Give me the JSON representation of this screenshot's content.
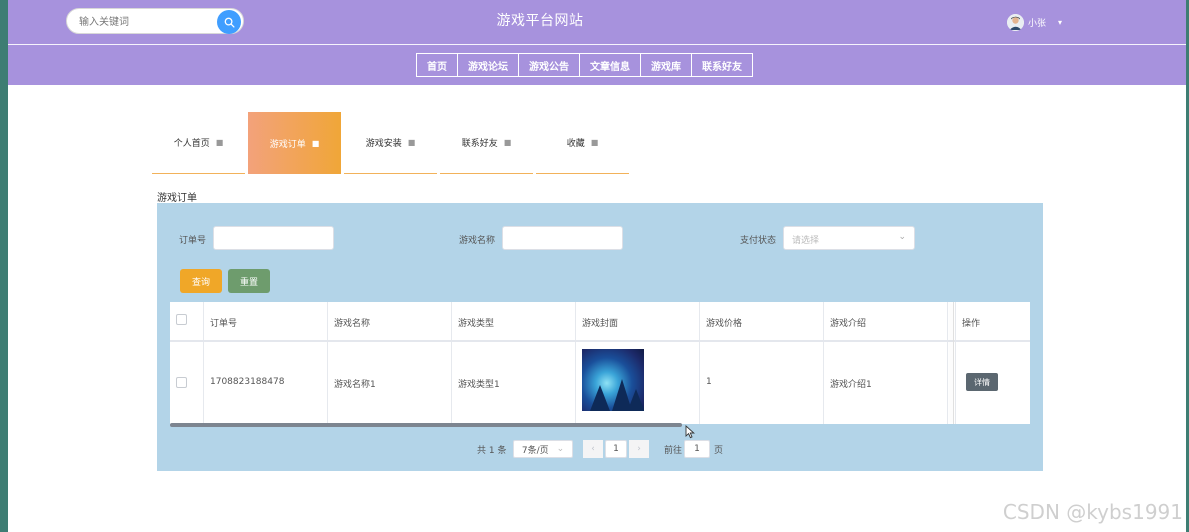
{
  "header": {
    "site_title": "游戏平台网站",
    "search_placeholder": "输入关键词",
    "user_name": "小张"
  },
  "nav": [
    "首页",
    "游戏论坛",
    "游戏公告",
    "文章信息",
    "游戏库",
    "联系好友"
  ],
  "tabs": [
    "个人首页",
    "游戏订单",
    "游戏安装",
    "联系好友",
    "收藏"
  ],
  "active_tab": "游戏订单",
  "section_title": "游戏订单",
  "filters": {
    "order_no_label": "订单号",
    "game_name_label": "游戏名称",
    "pay_status_label": "支付状态",
    "pay_status_placeholder": "请选择"
  },
  "buttons": {
    "query": "查询",
    "reset": "重置",
    "detail": "详情"
  },
  "table": {
    "columns": [
      "订单号",
      "游戏名称",
      "游戏类型",
      "游戏封面",
      "游戏价格",
      "游戏介绍",
      "操作"
    ],
    "rows": [
      {
        "order_no": "1708823188478",
        "game_name": "游戏名称1",
        "game_type": "游戏类型1",
        "price": "1",
        "intro": "游戏介绍1"
      }
    ]
  },
  "pagination": {
    "total": "共 1 条",
    "page_size": "7条/页",
    "current_page": "1",
    "goto_label": "前往",
    "goto_value": "1",
    "page_suffix": "页"
  },
  "watermark": "CSDN @kybs1991",
  "colors": {
    "header_bg": "#a792dd",
    "active_tab_from": "#f3a27b",
    "active_tab_to": "#f0a638",
    "panel_bg": "#b3d4e8",
    "query_btn": "#f0a728",
    "reset_btn": "#6e9c6d",
    "search_btn": "#409eff"
  }
}
